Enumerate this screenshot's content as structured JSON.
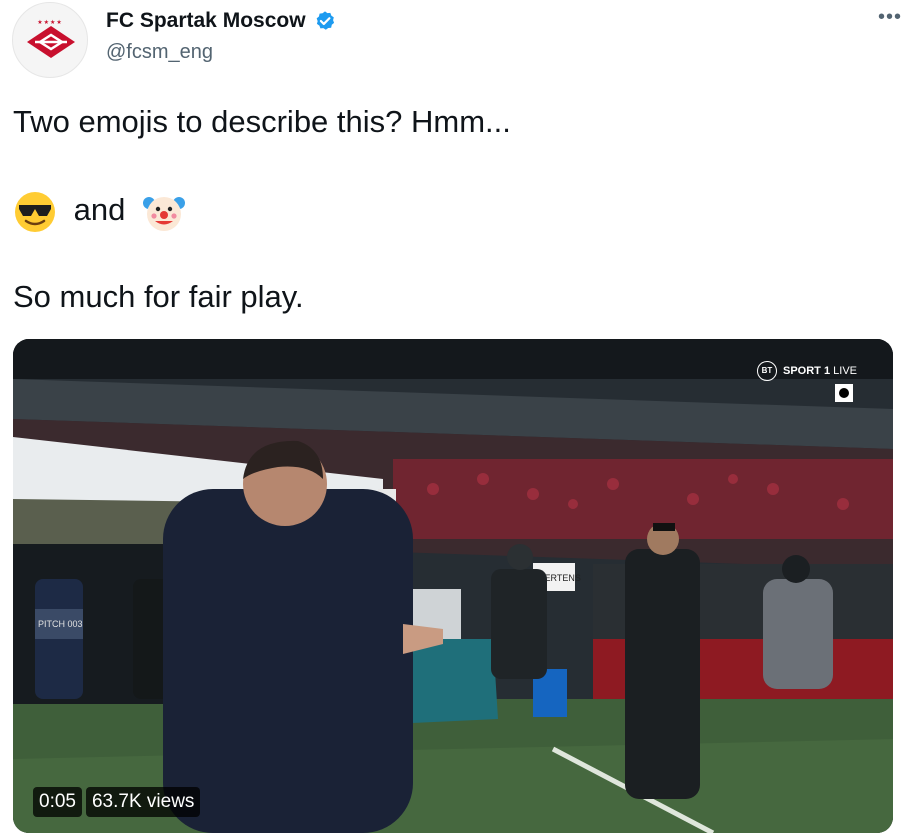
{
  "tweet": {
    "author": {
      "display_name": "FC Spartak Moscow",
      "handle": "@fcsm_eng",
      "verified": true,
      "avatar_icon": "spartak-rhombus-logo"
    },
    "more_label": "•••",
    "text": {
      "line1": "Two emojis to describe this? Hmm...",
      "emoji1": "😎",
      "connector": "and",
      "emoji2": "🤡",
      "line3": "So much for fair play."
    },
    "media": {
      "type": "video",
      "duration": "0:05",
      "views": "63.7K views",
      "broadcaster": {
        "logo": "BT",
        "channel": "SPORT 1",
        "status": "LIVE"
      },
      "sign_text": "MERTENS",
      "bib_text": "PITCH 003"
    }
  },
  "colors": {
    "verified_blue": "#1d9bf0",
    "secondary_text": "#536471",
    "brand_red": "#c8102e"
  }
}
